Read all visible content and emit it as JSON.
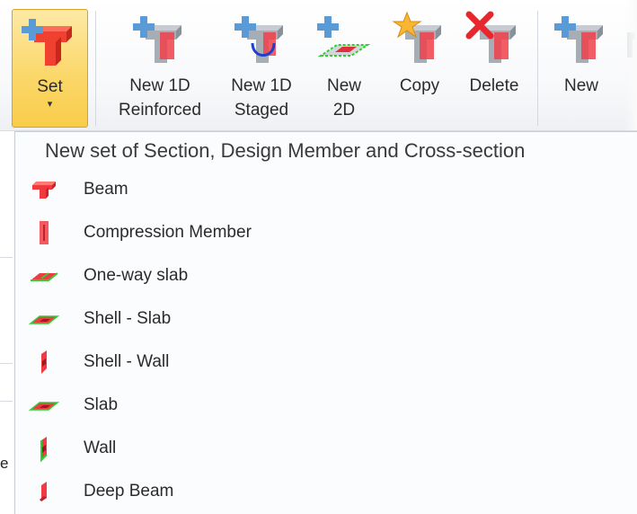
{
  "ribbon": {
    "buttons": [
      {
        "id": "set",
        "label": "Set",
        "arrow": "▾",
        "icon": "set-icon"
      },
      {
        "id": "new-1d-reinforced",
        "label_line1": "New 1D",
        "label_line2": "Reinforced",
        "icon": "new-1d-reinforced-icon"
      },
      {
        "id": "new-1d-staged",
        "label_line1": "New 1D",
        "label_line2": "Staged",
        "icon": "new-1d-staged-icon"
      },
      {
        "id": "new-2d",
        "label_line1": "New",
        "label_line2": "2D",
        "icon": "new-2d-icon"
      },
      {
        "id": "copy",
        "label_line1": "Copy",
        "label_line2": "",
        "icon": "copy-icon"
      },
      {
        "id": "delete",
        "label_line1": "Delete",
        "label_line2": "",
        "icon": "delete-icon"
      },
      {
        "id": "new",
        "label_line1": "New",
        "label_line2": "",
        "icon": "new-icon"
      }
    ]
  },
  "dropdown": {
    "title": "New set of Section, Design Member and Cross-section",
    "items": [
      {
        "label": "Beam",
        "icon": "beam-icon"
      },
      {
        "label": "Compression Member",
        "icon": "compression-member-icon"
      },
      {
        "label": "One-way slab",
        "icon": "one-way-slab-icon"
      },
      {
        "label": "Shell - Slab",
        "icon": "shell-slab-icon"
      },
      {
        "label": "Shell - Wall",
        "icon": "shell-wall-icon"
      },
      {
        "label": "Slab",
        "icon": "slab-icon"
      },
      {
        "label": "Wall",
        "icon": "wall-icon"
      },
      {
        "label": "Deep Beam",
        "icon": "deep-beam-icon"
      }
    ]
  },
  "background": {
    "left_fragment": "e"
  },
  "colors": {
    "accent_red": "#e8383b",
    "accent_blue": "#4f8fcf",
    "hover_yellow": "#fbd86b",
    "green_mesh": "#33cc33"
  }
}
